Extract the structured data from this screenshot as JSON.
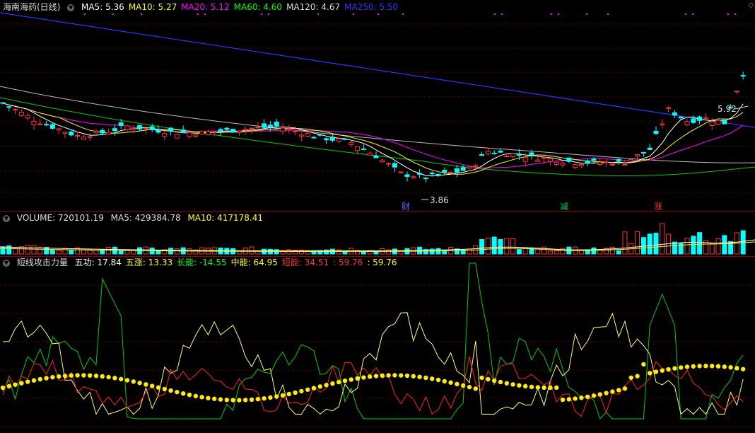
{
  "price_panel": {
    "stock_name": "海南海药(日线)",
    "ma_labels": [
      {
        "text": "MA5: 5.36",
        "color": "#ffffff"
      },
      {
        "text": "MA10: 5.27",
        "color": "#ffff00"
      },
      {
        "text": "MA20: 5.12",
        "color": "#ff00ff"
      },
      {
        "text": "MA60: 4.60",
        "color": "#00ff00"
      },
      {
        "text": "MA120: 4.67",
        "color": "#dddddd"
      },
      {
        "text": "MA250: 5.50",
        "color": "#3333ff"
      }
    ],
    "high_label": "5.92",
    "low_label": "3.86",
    "markers": [
      {
        "text": "财",
        "color": "#4a78ff"
      },
      {
        "text": "减",
        "color": "#00cc66"
      },
      {
        "text": "涨",
        "color": "#ff3333"
      }
    ]
  },
  "volume_panel": {
    "label": "VOLUME: 720101.19",
    "ma5": "MA5: 429384.78",
    "ma10": "MA10: 417178.41"
  },
  "indicator_panel": {
    "name": "短线攻击力量",
    "items": [
      {
        "text": "五功: 17.84",
        "color": "#ffffff"
      },
      {
        "text": "五涨: 13.33",
        "color": "#ffff00"
      },
      {
        "text": "长能: -14.55",
        "color": "#00ff00"
      },
      {
        "text": "中能: 64.95",
        "color": "#ffff00"
      },
      {
        "text": "短能: 34.51",
        "color": "#ff3333"
      },
      {
        "text": ": 59.76",
        "color": "#ff3333"
      },
      {
        "text": ": 59.76",
        "color": "#ffff00"
      }
    ]
  },
  "chart_data": {
    "type": "candlestick",
    "candles_count": 120,
    "price_range": [
      3.5,
      6.4
    ],
    "price_levels": [
      3.86,
      5.92
    ]
  }
}
